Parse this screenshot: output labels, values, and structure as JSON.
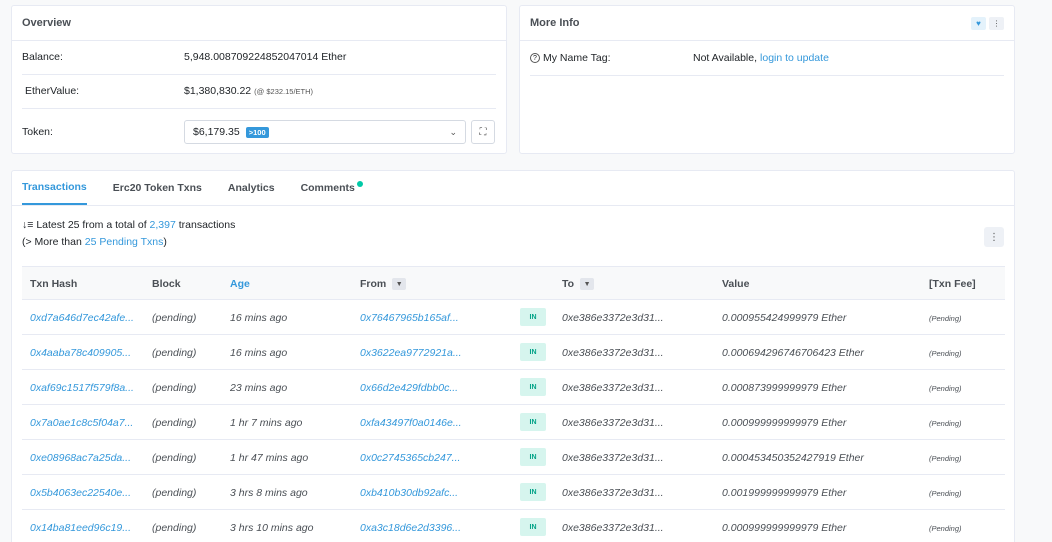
{
  "overview": {
    "title": "Overview",
    "balance_label": "Balance:",
    "balance_value": "5,948.008709224852047014 Ether",
    "ethervalue_label": "EtherValue:",
    "ethervalue_value": "$1,380,830.22",
    "ethervalue_rate": "(@ $232.15/ETH)",
    "token_label": "Token:",
    "token_value": "$6,179.35",
    "token_badge": ">100",
    "token_chevron_icon": "chevron-down-icon",
    "expand_icon": "expand-icon"
  },
  "moreinfo": {
    "title": "More Info",
    "heart_icon": "heart-icon",
    "kebab_icon": "kebab-icon",
    "name_tag_label": "My Name Tag:",
    "name_tag_value": "Not Available,",
    "name_tag_link": "login to update"
  },
  "tabs": [
    {
      "label": "Transactions",
      "active": true
    },
    {
      "label": "Erc20 Token Txns",
      "active": false
    },
    {
      "label": "Analytics",
      "active": false
    },
    {
      "label": "Comments",
      "active": false
    }
  ],
  "summary": {
    "line1_prefix": "Latest 25 from a total of",
    "total": "2,397",
    "line1_suffix": "transactions",
    "line2_prefix": "(> More than",
    "pending_link": "25 Pending Txns",
    "line2_suffix": ")"
  },
  "table": {
    "headers": {
      "txn_hash": "Txn Hash",
      "block": "Block",
      "age": "Age",
      "from": "From",
      "to": "To",
      "value": "Value",
      "fee": "[Txn Fee]"
    },
    "rows": [
      {
        "hash": "0xd7a646d7ec42afe...",
        "block": "(pending)",
        "age": "16 mins ago",
        "from": "0x76467965b165af...",
        "dir": "IN",
        "to": "0xe386e3372e3d31...",
        "value": "0.000955424999979 Ether",
        "fee": "(Pending)"
      },
      {
        "hash": "0x4aaba78c409905...",
        "block": "(pending)",
        "age": "16 mins ago",
        "from": "0x3622ea9772921a...",
        "dir": "IN",
        "to": "0xe386e3372e3d31...",
        "value": "0.000694296746706423 Ether",
        "fee": "(Pending)"
      },
      {
        "hash": "0xaf69c1517f579f8a...",
        "block": "(pending)",
        "age": "23 mins ago",
        "from": "0x66d2e429fdbb0c...",
        "dir": "IN",
        "to": "0xe386e3372e3d31...",
        "value": "0.000873999999979 Ether",
        "fee": "(Pending)"
      },
      {
        "hash": "0x7a0ae1c8c5f04a7...",
        "block": "(pending)",
        "age": "1 hr 7 mins ago",
        "from": "0xfa43497f0a0146e...",
        "dir": "IN",
        "to": "0xe386e3372e3d31...",
        "value": "0.000999999999979 Ether",
        "fee": "(Pending)"
      },
      {
        "hash": "0xe08968ac7a25da...",
        "block": "(pending)",
        "age": "1 hr 47 mins ago",
        "from": "0x0c2745365cb247...",
        "dir": "IN",
        "to": "0xe386e3372e3d31...",
        "value": "0.000453450352427919 Ether",
        "fee": "(Pending)"
      },
      {
        "hash": "0x5b4063ec22540e...",
        "block": "(pending)",
        "age": "3 hrs 8 mins ago",
        "from": "0xb410b30db92afc...",
        "dir": "IN",
        "to": "0xe386e3372e3d31...",
        "value": "0.001999999999979 Ether",
        "fee": "(Pending)"
      },
      {
        "hash": "0x14ba81eed96c19...",
        "block": "(pending)",
        "age": "3 hrs 10 mins ago",
        "from": "0xa3c18d6e2d3396...",
        "dir": "IN",
        "to": "0xe386e3372e3d31...",
        "value": "0.000999999999979 Ether",
        "fee": "(Pending)"
      }
    ]
  }
}
